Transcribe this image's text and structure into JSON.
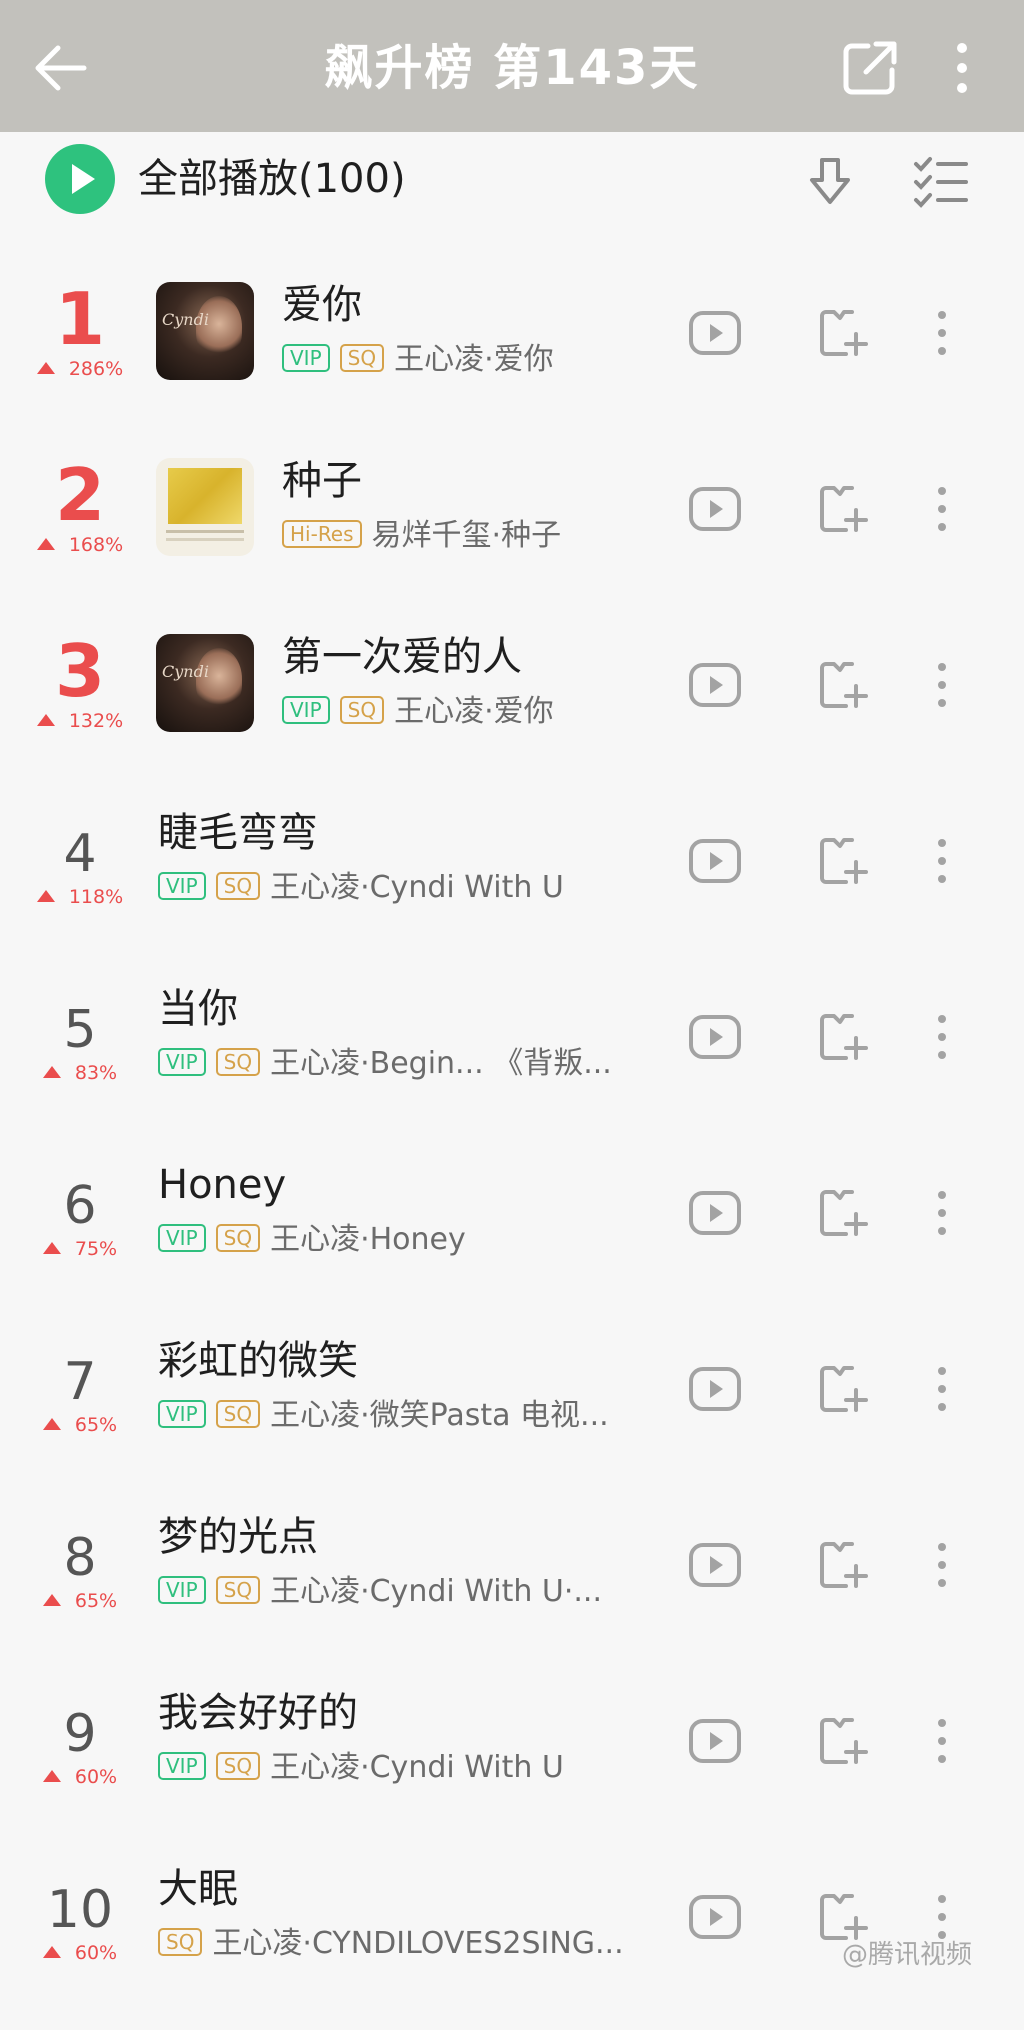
{
  "header": {
    "title": "飙升榜 第143天"
  },
  "playall": {
    "label": "全部播放(100)"
  },
  "songs": [
    {
      "rank": "1",
      "change": "286%",
      "title": "爱你",
      "tags": [
        "VIP",
        "SQ"
      ],
      "meta": "王心凌·爱你",
      "cover": "dark"
    },
    {
      "rank": "2",
      "change": "168%",
      "title": "种子",
      "tags": [
        "Hi-Res"
      ],
      "meta": "易烊千玺·种子",
      "cover": "gold"
    },
    {
      "rank": "3",
      "change": "132%",
      "title": "第一次爱的人",
      "tags": [
        "VIP",
        "SQ"
      ],
      "meta": "王心凌·爱你",
      "cover": "dark"
    },
    {
      "rank": "4",
      "change": "118%",
      "title": "睫毛弯弯",
      "tags": [
        "VIP",
        "SQ"
      ],
      "meta": "王心凌·Cyndi With U"
    },
    {
      "rank": "5",
      "change": "83%",
      "title": "当你",
      "tags": [
        "VIP",
        "SQ"
      ],
      "meta": "王心凌·Begin... 《背叛..."
    },
    {
      "rank": "6",
      "change": "75%",
      "title": "Honey",
      "tags": [
        "VIP",
        "SQ"
      ],
      "meta": "王心凌·Honey"
    },
    {
      "rank": "7",
      "change": "65%",
      "title": "彩虹的微笑",
      "tags": [
        "VIP",
        "SQ"
      ],
      "meta": "王心凌·微笑Pasta 电视..."
    },
    {
      "rank": "8",
      "change": "65%",
      "title": "梦的光点",
      "tags": [
        "VIP",
        "SQ"
      ],
      "meta": "王心凌·Cyndi With U·..."
    },
    {
      "rank": "9",
      "change": "60%",
      "title": "我会好好的",
      "tags": [
        "VIP",
        "SQ"
      ],
      "meta": "王心凌·Cyndi With U"
    },
    {
      "rank": "10",
      "change": "60%",
      "title": "大眠",
      "tags": [
        "SQ"
      ],
      "meta": "王心凌·CYNDILOVES2SING..."
    }
  ],
  "cover_text": "Cyndi",
  "watermark": "@腾讯视频",
  "colors": {
    "topbar": "#c2c1bc",
    "accent_green": "#2ec27e",
    "rank_red": "#ea4d4d",
    "vip_green": "#2fbf7e",
    "sq_gold": "#d5a24a"
  },
  "icons": [
    "back-arrow-icon",
    "share-icon",
    "more-vertical-icon",
    "play-icon",
    "download-icon",
    "multi-select-icon",
    "mv-play-icon",
    "add-to-playlist-icon",
    "row-more-icon"
  ]
}
